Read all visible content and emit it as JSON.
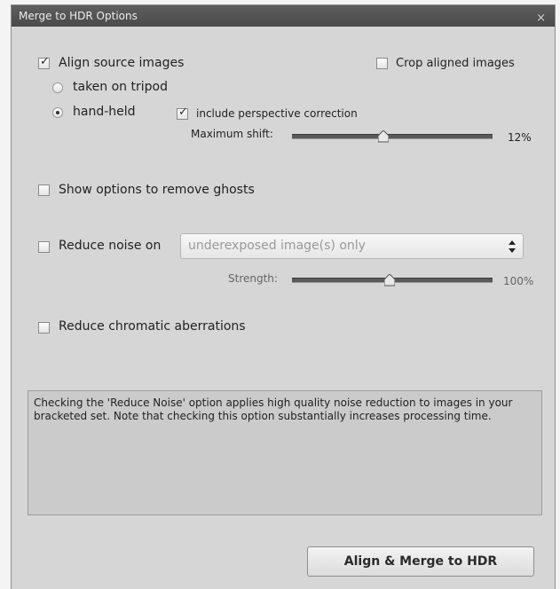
{
  "dialog": {
    "title": "Merge to HDR Options",
    "close_glyph": "×"
  },
  "align": {
    "label": "Align source images",
    "checked": true,
    "tripod_label": "taken on tripod",
    "handheld_label": "hand-held",
    "selected_mode": "hand-held",
    "perspective_label": "include perspective correction",
    "perspective_checked": true,
    "max_shift_label": "Maximum shift:",
    "max_shift_value": "12%"
  },
  "crop": {
    "label": "Crop aligned images",
    "checked": false
  },
  "ghosts": {
    "label": "Show options to remove ghosts",
    "checked": false
  },
  "noise": {
    "label": "Reduce noise on",
    "checked": false,
    "select_value": "underexposed image(s) only",
    "strength_label": "Strength:",
    "strength_value": "100%"
  },
  "chromatic": {
    "label": "Reduce chromatic aberrations",
    "checked": false
  },
  "info_text": "Checking the 'Reduce Noise' option applies high quality noise reduction to images in your bracketed set. Note that checking this option substantially increases processing time.",
  "buttons": {
    "merge_label": "Align & Merge to HDR"
  },
  "icons": {
    "close": "close-icon",
    "check": "checkmark-icon",
    "select_arrows": "up-down-arrows-icon",
    "slider_thumb": "slider-thumb-icon"
  },
  "colors": {
    "titlebar": "#4f4f4f",
    "panel": "#d6d6d6",
    "info_box": "#cbcbcb",
    "slider_track": "#5a5a5a"
  }
}
